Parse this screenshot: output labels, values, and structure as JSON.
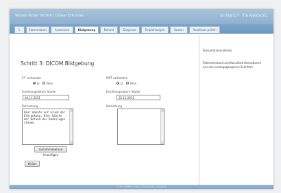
{
  "window": {
    "title": "Wissen sicher fördern | Gräser Erkunden",
    "brand": "VIMEDT TENEDOC"
  },
  "tabs": [
    {
      "label": "1."
    },
    {
      "label": "Stammdaten"
    },
    {
      "label": "Anamnese"
    },
    {
      "label": "Bildgebung"
    },
    {
      "label": "Befund"
    },
    {
      "label": "Diagnose"
    },
    {
      "label": "Empfehlungen"
    },
    {
      "label": "Kosten"
    },
    {
      "label": "Abschluss prüfen"
    }
  ],
  "active_tab": "Bildgebung",
  "main": {
    "heading": "Schritt 3: DICOM Bildgebung",
    "left": {
      "radio_label": "CT vorhanden",
      "radio_options": [
        {
          "label": "Ja",
          "selected": true
        },
        {
          "label": "Nein",
          "selected": false
        }
      ],
      "date_label": "Erstellungsdatum Studie",
      "date_value": "04.11.2011",
      "notes_label": "Bemerkung",
      "notes_value": "Hier könnte auf Grund der Erkrankung. Hier könnte der Befund des Radiologen stehen.",
      "add_button": "Aufnahmebefund hinzufügen"
    },
    "right": {
      "radio_label": "MRT vorhanden",
      "radio_options": [
        {
          "label": "Ja",
          "selected": true
        },
        {
          "label": "Nein",
          "selected": false
        }
      ],
      "date_label": "Erstellungsdatum Studie",
      "date_value": "02.11.2011",
      "notes_label": "Bemerkung",
      "notes_value": ""
    },
    "next_button": "Weiter"
  },
  "side": {
    "heading": "Konsultationsrahmen",
    "text": "Patientenstand und Konsiliarinformationen aus den vorangegangenen Schritten"
  },
  "footer": {
    "text": "© 2011 VIMEDT TeleDoc | Alle Rechte vorbehalten"
  }
}
